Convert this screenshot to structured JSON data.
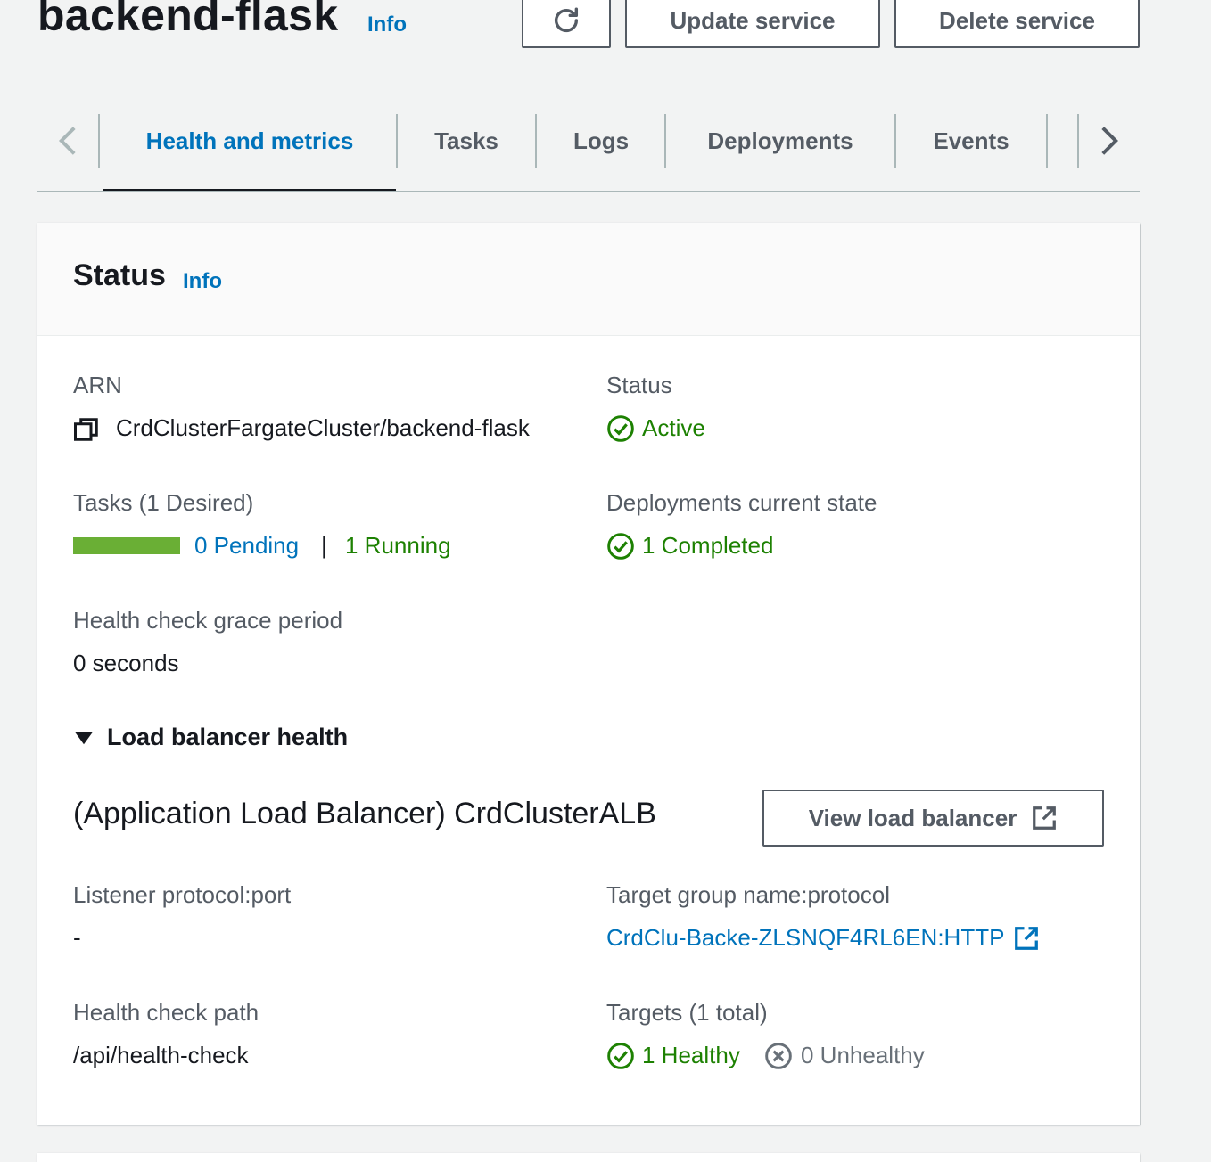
{
  "header": {
    "title": "backend-flask",
    "info": "Info",
    "refresh_icon": "refresh-icon",
    "update_label": "Update service",
    "delete_label": "Delete service"
  },
  "tabs": {
    "items": [
      {
        "label": "Health and metrics",
        "active": true
      },
      {
        "label": "Tasks"
      },
      {
        "label": "Logs"
      },
      {
        "label": "Deployments"
      },
      {
        "label": "Events"
      }
    ],
    "prev_icon": "chevron-left-icon",
    "next_icon": "chevron-right-icon"
  },
  "status_panel": {
    "title": "Status",
    "info": "Info",
    "arn": {
      "label": "ARN",
      "value": "CrdClusterFargateCluster/backend-flask",
      "icon": "copy-icon"
    },
    "status": {
      "label": "Status",
      "value": "Active",
      "icon": "check-circle-icon"
    },
    "tasks": {
      "label": "Tasks (1 Desired)",
      "pending": "0 Pending",
      "separator": "|",
      "running": "1 Running",
      "running_fraction": 1.0
    },
    "deployments": {
      "label": "Deployments current state",
      "value": "1 Completed",
      "icon": "check-circle-icon"
    },
    "grace": {
      "label": "Health check grace period",
      "value": "0 seconds"
    },
    "lb_section": {
      "label": "Load balancer health",
      "icon": "caret-down-icon"
    },
    "lb_name": "(Application Load Balancer) CrdClusterALB",
    "view_lb_label": "View load balancer",
    "listener": {
      "label": "Listener protocol:port",
      "value": "-"
    },
    "target_group": {
      "label": "Target group name:protocol",
      "value": "CrdClu-Backe-ZLSNQF4RL6EN:HTTP",
      "icon": "external-link-icon"
    },
    "health_path": {
      "label": "Health check path",
      "value": "/api/health-check"
    },
    "targets": {
      "label": "Targets (1 total)",
      "healthy": "1 Healthy",
      "unhealthy": "0 Unhealthy"
    }
  },
  "colors": {
    "accent": "#0073bb",
    "success": "#1d8102",
    "bar": "#6aaf35"
  }
}
